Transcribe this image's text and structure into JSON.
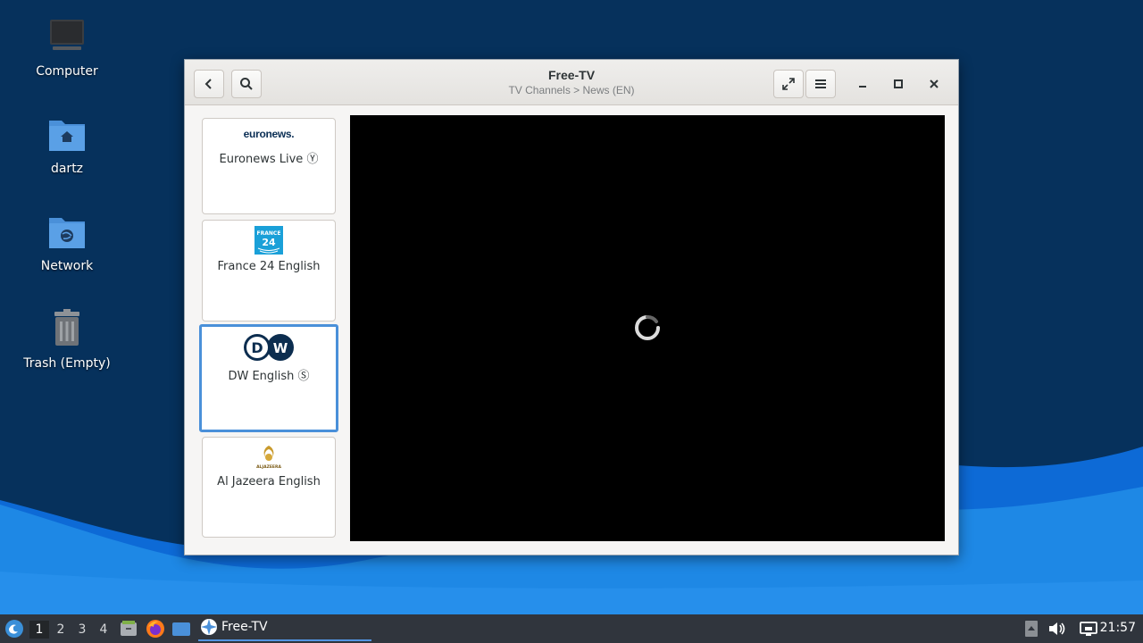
{
  "desktop": {
    "icons": [
      {
        "label": "Computer",
        "icon": "computer-icon"
      },
      {
        "label": "dartz",
        "icon": "home-folder-icon"
      },
      {
        "label": "Network",
        "icon": "network-folder-icon"
      },
      {
        "label": "Trash (Empty)",
        "icon": "trash-icon"
      }
    ],
    "colors": {
      "background": "#06315c",
      "wave_light": "#1e88e5",
      "wave_dark": "#0d6ad6"
    }
  },
  "window": {
    "title": "Free-TV",
    "subtitle": "TV Channels > News (EN)",
    "buttons": {
      "back": "back-arrow-icon",
      "search": "search-icon",
      "fullscreen": "fullscreen-icon",
      "menu": "hamburger-menu-icon",
      "minimize": "minimize-icon",
      "maximize": "maximize-icon",
      "close": "close-icon"
    },
    "channels": [
      {
        "name": "Euronews Live",
        "badge": "Ⓨ",
        "logo_text": "euronews.",
        "logo": "euronews-logo",
        "selected": false
      },
      {
        "name": "France 24 English",
        "badge": "",
        "logo_text": "FRANCE 24",
        "logo": "france24-logo",
        "selected": false
      },
      {
        "name": "DW English",
        "badge": "Ⓢ",
        "logo_text": "DW",
        "logo": "dw-logo",
        "selected": true
      },
      {
        "name": "Al Jazeera English",
        "badge": "",
        "logo_text": "ALJAZEERA",
        "logo": "aljazeera-logo",
        "selected": false
      }
    ],
    "player": {
      "state": "loading",
      "spinner": "loading-spinner-icon",
      "background": "#000000"
    },
    "selection_color": "#4a90d9"
  },
  "taskbar": {
    "start_icon": "distro-logo-icon",
    "workspaces": [
      "1",
      "2",
      "3",
      "4"
    ],
    "active_workspace": "1",
    "launchers": [
      "file-manager-icon",
      "firefox-icon",
      "show-desktop-icon"
    ],
    "task": {
      "label": "Free-TV",
      "icon": "freetv-app-icon"
    },
    "tray": [
      "notification-icon",
      "volume-icon",
      "network-wired-icon"
    ],
    "clock": "21:57"
  }
}
